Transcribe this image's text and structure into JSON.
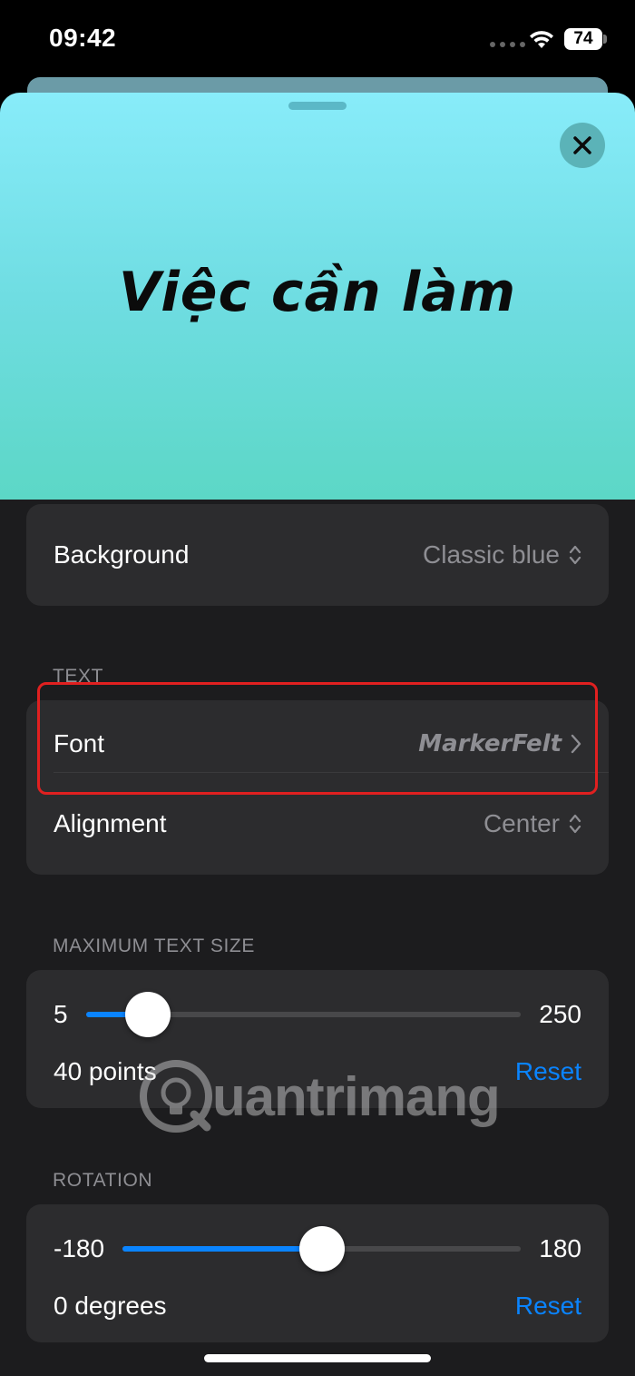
{
  "status_bar": {
    "time": "09:42",
    "battery": "74"
  },
  "preview": {
    "text": "Việc cần làm"
  },
  "background_row": {
    "label": "Background",
    "value": "Classic blue"
  },
  "text_section": {
    "header": "TEXT",
    "font": {
      "label": "Font",
      "value": "MarkerFelt"
    },
    "alignment": {
      "label": "Alignment",
      "value": "Center"
    }
  },
  "text_size": {
    "header": "MAXIMUM TEXT SIZE",
    "min": "5",
    "max": "250",
    "value": 40,
    "value_label": "40 points",
    "reset": "Reset"
  },
  "rotation": {
    "header": "ROTATION",
    "min": "-180",
    "max": "180",
    "value": 0,
    "value_label": "0 degrees",
    "reset": "Reset"
  },
  "watermark": {
    "text": "uantrimang"
  },
  "colors": {
    "accent": "#0a84ff",
    "highlight": "#e02020",
    "preview_top": "#88ecfa",
    "preview_bottom": "#5cd7c6"
  }
}
